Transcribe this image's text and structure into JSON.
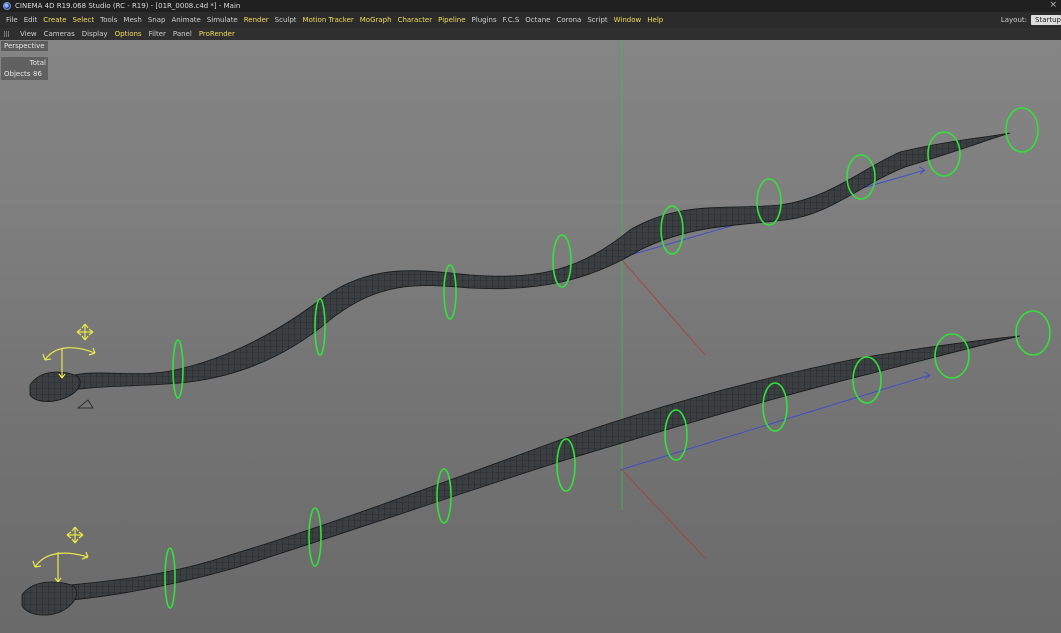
{
  "window": {
    "title": "CINEMA 4D R19.068 Studio (RC - R19) - [01R_0008.c4d *] - Main",
    "close_glyph": "×"
  },
  "menubar": {
    "items": [
      {
        "label": "File",
        "highlight": false
      },
      {
        "label": "Edit",
        "highlight": false
      },
      {
        "label": "Create",
        "highlight": true
      },
      {
        "label": "Select",
        "highlight": true
      },
      {
        "label": "Tools",
        "highlight": false
      },
      {
        "label": "Mesh",
        "highlight": false
      },
      {
        "label": "Snap",
        "highlight": false
      },
      {
        "label": "Animate",
        "highlight": false
      },
      {
        "label": "Simulate",
        "highlight": false
      },
      {
        "label": "Render",
        "highlight": true
      },
      {
        "label": "Sculpt",
        "highlight": false
      },
      {
        "label": "Motion Tracker",
        "highlight": true
      },
      {
        "label": "MoGraph",
        "highlight": true
      },
      {
        "label": "Character",
        "highlight": true
      },
      {
        "label": "Pipeline",
        "highlight": true
      },
      {
        "label": "Plugins",
        "highlight": false
      },
      {
        "label": "F.C.S",
        "highlight": false
      },
      {
        "label": "Octane",
        "highlight": false
      },
      {
        "label": "Corona",
        "highlight": false
      },
      {
        "label": "Script",
        "highlight": false
      },
      {
        "label": "Window",
        "highlight": true
      },
      {
        "label": "Help",
        "highlight": true
      }
    ],
    "layout_label": "Layout:",
    "layout_value": "Startup"
  },
  "viewport_menu": {
    "items": [
      {
        "label": "View",
        "highlight": false
      },
      {
        "label": "Cameras",
        "highlight": false
      },
      {
        "label": "Display",
        "highlight": false
      },
      {
        "label": "Options",
        "highlight": true
      },
      {
        "label": "Filter",
        "highlight": false
      },
      {
        "label": "Panel",
        "highlight": false
      },
      {
        "label": "ProRender",
        "highlight": true
      }
    ]
  },
  "viewport": {
    "camera": "Perspective",
    "stats": {
      "header": "Total",
      "label": "Objects",
      "value": "86"
    },
    "colors": {
      "mesh_fill": "#3b3f42",
      "wire": "#15181a",
      "spline_rings": "#33e23a",
      "manipulator": "#e8e64a",
      "axis_y": "#3fbe3f",
      "axis_x": "#b03a3a",
      "axis_z": "#3a4bd0"
    }
  }
}
